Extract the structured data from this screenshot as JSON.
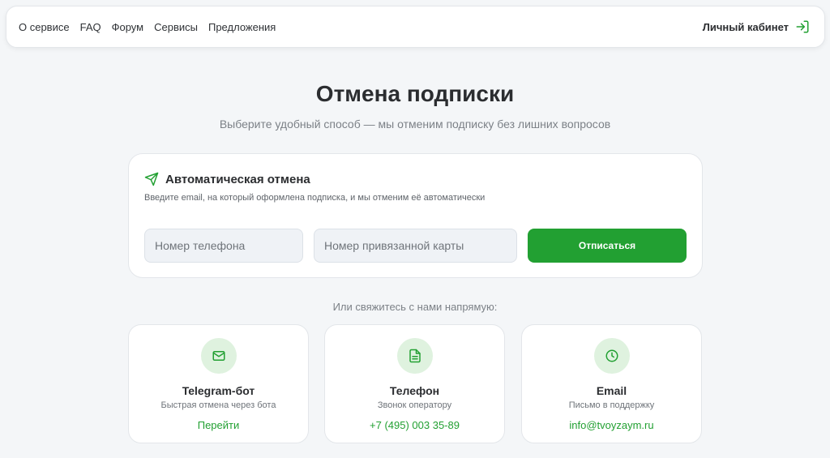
{
  "nav": {
    "links": [
      "О сервисе",
      "FAQ",
      "Форум",
      "Сервисы",
      "Предложения"
    ],
    "account_label": "Личный кабинет"
  },
  "header": {
    "title": "Отмена подписки",
    "subtitle": "Выберите удобный способ — мы отменим подписку без лишних вопросов"
  },
  "auto_cancel": {
    "title": "Автоматическая отмена",
    "description": "Введите email, на который оформлена подписка, и мы отменим её автоматически",
    "phone_placeholder": "Номер телефона",
    "card_placeholder": "Номер привязанной карты",
    "button_label": "Отписаться"
  },
  "contact": {
    "heading": "Или свяжитесь с нами напрямую:",
    "cards": [
      {
        "title": "Telegram-бот",
        "subtitle": "Быстрая отмена через бота",
        "link": "Перейти",
        "icon": "mail-icon"
      },
      {
        "title": "Телефон",
        "subtitle": "Звонок оператору",
        "link": "+7 (495) 003 35-89",
        "icon": "document-icon"
      },
      {
        "title": "Email",
        "subtitle": "Письмо в поддержку",
        "link": "info@tvoyzaym.ru",
        "icon": "clock-icon"
      }
    ]
  },
  "colors": {
    "accent": "#22a032",
    "icon_bg": "#dff2df",
    "background": "#f4f6f8"
  }
}
